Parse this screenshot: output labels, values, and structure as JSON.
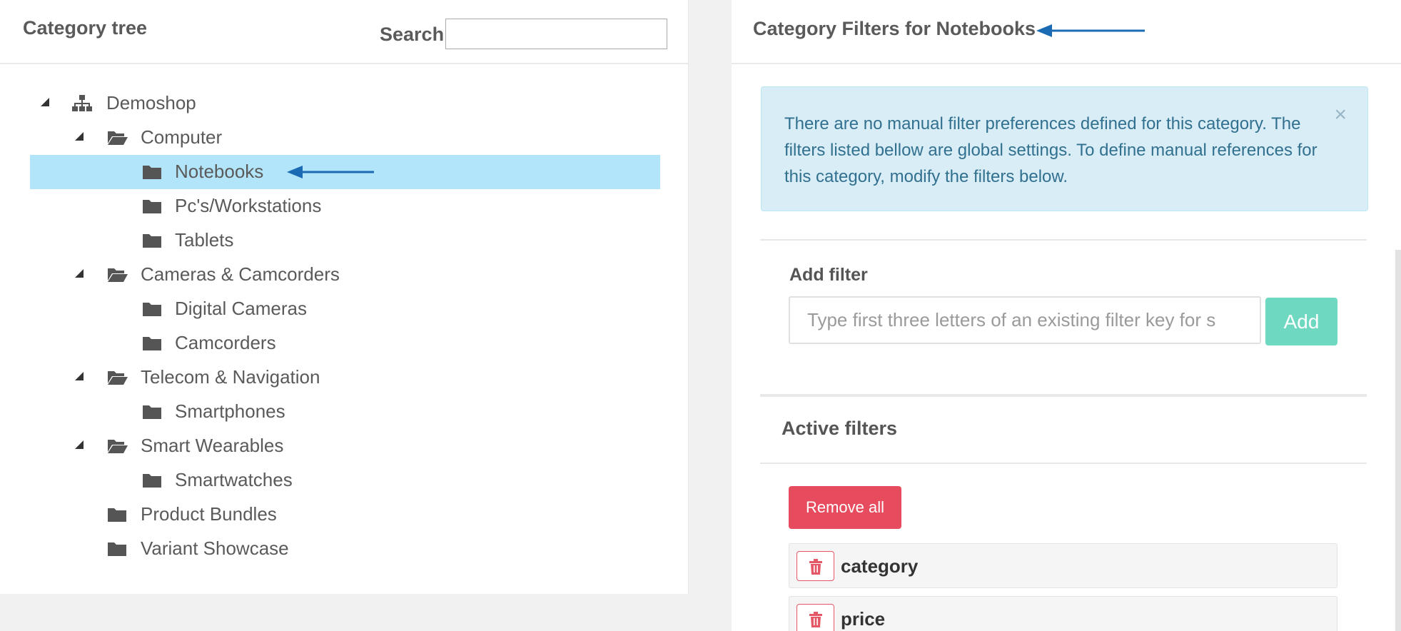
{
  "category_tree": {
    "title": "Category tree",
    "search_label": "Search:",
    "search_value": "",
    "items": [
      {
        "label": "Demoshop",
        "icon": "sitemap-icon",
        "expanded": true,
        "level": 0
      },
      {
        "label": "Computer",
        "icon": "folder-open-icon",
        "expanded": true,
        "level": 1
      },
      {
        "label": "Notebooks",
        "icon": "folder-icon",
        "level": 2,
        "selected": true
      },
      {
        "label": "Pc's/Workstations",
        "icon": "folder-icon",
        "level": 2
      },
      {
        "label": "Tablets",
        "icon": "folder-icon",
        "level": 2
      },
      {
        "label": "Cameras & Camcorders",
        "icon": "folder-open-icon",
        "expanded": true,
        "level": 1
      },
      {
        "label": "Digital Cameras",
        "icon": "folder-icon",
        "level": 2
      },
      {
        "label": "Camcorders",
        "icon": "folder-icon",
        "level": 2
      },
      {
        "label": "Telecom & Navigation",
        "icon": "folder-open-icon",
        "expanded": true,
        "level": 1
      },
      {
        "label": "Smartphones",
        "icon": "folder-icon",
        "level": 2
      },
      {
        "label": "Smart Wearables",
        "icon": "folder-open-icon",
        "expanded": true,
        "level": 1
      },
      {
        "label": "Smartwatches",
        "icon": "folder-icon",
        "level": 2
      },
      {
        "label": "Product Bundles",
        "icon": "folder-icon",
        "level": 1
      },
      {
        "label": "Variant Showcase",
        "icon": "folder-icon",
        "level": 1
      }
    ]
  },
  "category_filters": {
    "title": "Category Filters for Notebooks",
    "info_alert": {
      "text": "There are no manual filter preferences defined for this category. The filters listed bellow are global settings. To define manual references for this category, modify the filters below.",
      "close_symbol": "×"
    },
    "add_filter": {
      "label": "Add filter",
      "input_placeholder": "Type first three letters of an existing filter key for s",
      "input_value": "",
      "button_label": "Add"
    },
    "active_filters": {
      "label": "Active filters",
      "remove_all_label": "Remove all",
      "filters": [
        {
          "name": "category"
        },
        {
          "name": "price"
        }
      ]
    }
  },
  "colors": {
    "selected_row": "#b3e5fa",
    "annotation_arrow": "#1a6bb3",
    "alert_bg": "#d9edf7",
    "alert_text": "#31708f",
    "add_button": "#6fd8c1",
    "remove_button": "#e74c5e"
  }
}
